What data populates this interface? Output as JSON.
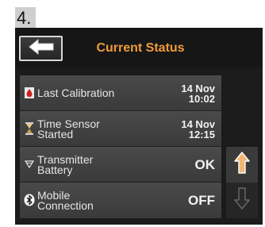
{
  "step": {
    "number": "4."
  },
  "header": {
    "title": "Current Status",
    "back_icon": "arrow-left-icon"
  },
  "rows": [
    {
      "icon": "blood-drop-icon",
      "label_line1": "Last Calibration",
      "label_line2": "",
      "value_line1": "14 Nov",
      "value_line2": "10:02"
    },
    {
      "icon": "hourglass-icon",
      "label_line1": "Time Sensor",
      "label_line2": "Started",
      "value_line1": "14 Nov",
      "value_line2": "12:15"
    },
    {
      "icon": "transmitter-icon",
      "label_line1": "Transmitter",
      "label_line2": "Battery",
      "value_line1": "OK",
      "value_line2": ""
    },
    {
      "icon": "bluetooth-icon",
      "label_line1": "Mobile",
      "label_line2": "Connection",
      "value_line1": "OFF",
      "value_line2": ""
    }
  ],
  "scroll": {
    "up_icon": "arrow-up-icon",
    "down_icon": "arrow-down-icon"
  },
  "colors": {
    "title": "#ef9b3c",
    "up_arrow": "#f2b774"
  }
}
